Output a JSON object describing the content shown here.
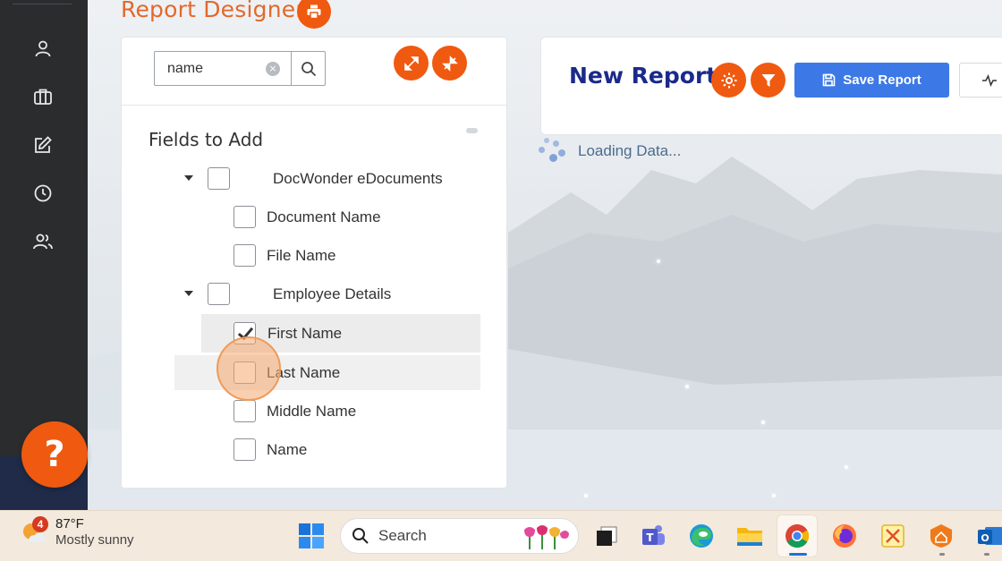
{
  "header": {
    "title": "Report Designer"
  },
  "fields_panel": {
    "search": {
      "value": "name",
      "clear_icon": "×"
    },
    "section_title": "Fields to Add",
    "tree": [
      {
        "type": "group",
        "label": "DocWonder eDocuments",
        "expanded": true,
        "checked": false
      },
      {
        "type": "field",
        "label": "Document Name",
        "checked": false
      },
      {
        "type": "field",
        "label": "File Name",
        "checked": false
      },
      {
        "type": "group",
        "label": "Employee Details",
        "expanded": true,
        "checked": false
      },
      {
        "type": "field",
        "label": "First Name",
        "checked": true,
        "highlighted": true
      },
      {
        "type": "field",
        "label": "Last Name",
        "checked": false,
        "hovered": true
      },
      {
        "type": "field",
        "label": "Middle Name",
        "checked": false
      },
      {
        "type": "field",
        "label": "Name",
        "checked": false
      }
    ]
  },
  "report": {
    "title": "New Report",
    "save_label": "Save Report",
    "loading_text": "Loading Data..."
  },
  "help": {
    "label": "?"
  },
  "taskbar": {
    "weather": {
      "badge": "4",
      "temp": "87°F",
      "desc": "Mostly sunny"
    },
    "search_label": "Search"
  },
  "colors": {
    "accent_orange": "#ef5a10",
    "title_orange": "#e2692b",
    "primary_blue": "#3c79e6",
    "report_title_navy": "#1b2a8a",
    "rail_dark": "#2b2c2e"
  }
}
